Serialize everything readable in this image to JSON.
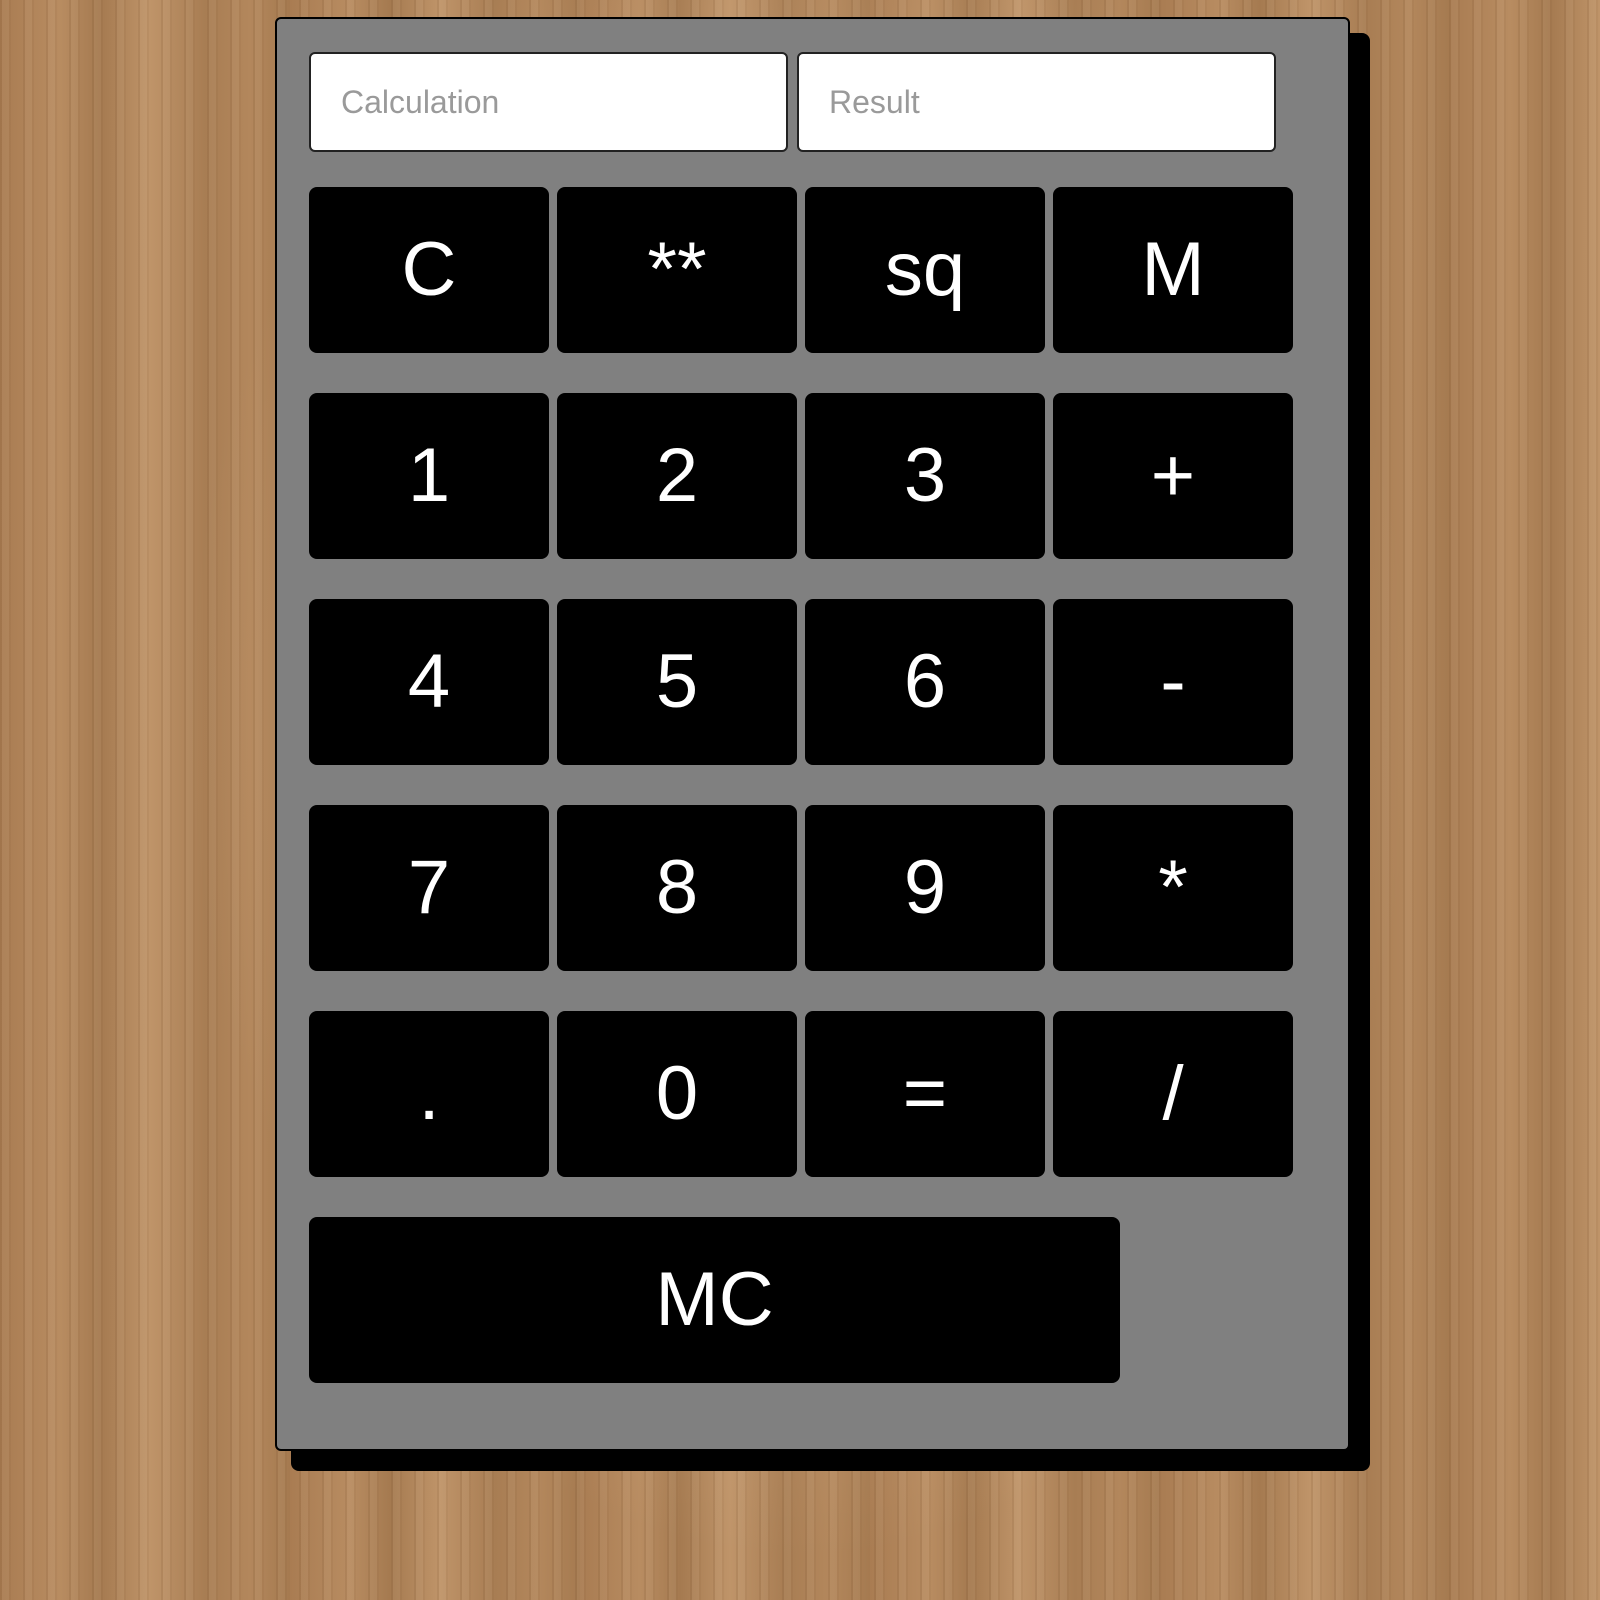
{
  "display": {
    "calculation_placeholder": "Calculation",
    "result_placeholder": "Result"
  },
  "keys": {
    "clear": "C",
    "power": "**",
    "sqrt": "sq",
    "memory": "M",
    "one": "1",
    "two": "2",
    "three": "3",
    "plus": "+",
    "four": "4",
    "five": "5",
    "six": "6",
    "minus": "-",
    "seven": "7",
    "eight": "8",
    "nine": "9",
    "multiply": "*",
    "decimal": ".",
    "zero": "0",
    "equals": "=",
    "divide": "/",
    "memory_clear": "MC"
  },
  "colors": {
    "panel": "#808080",
    "key": "#000000",
    "key_text": "#ffffff",
    "display_bg": "#ffffff"
  }
}
